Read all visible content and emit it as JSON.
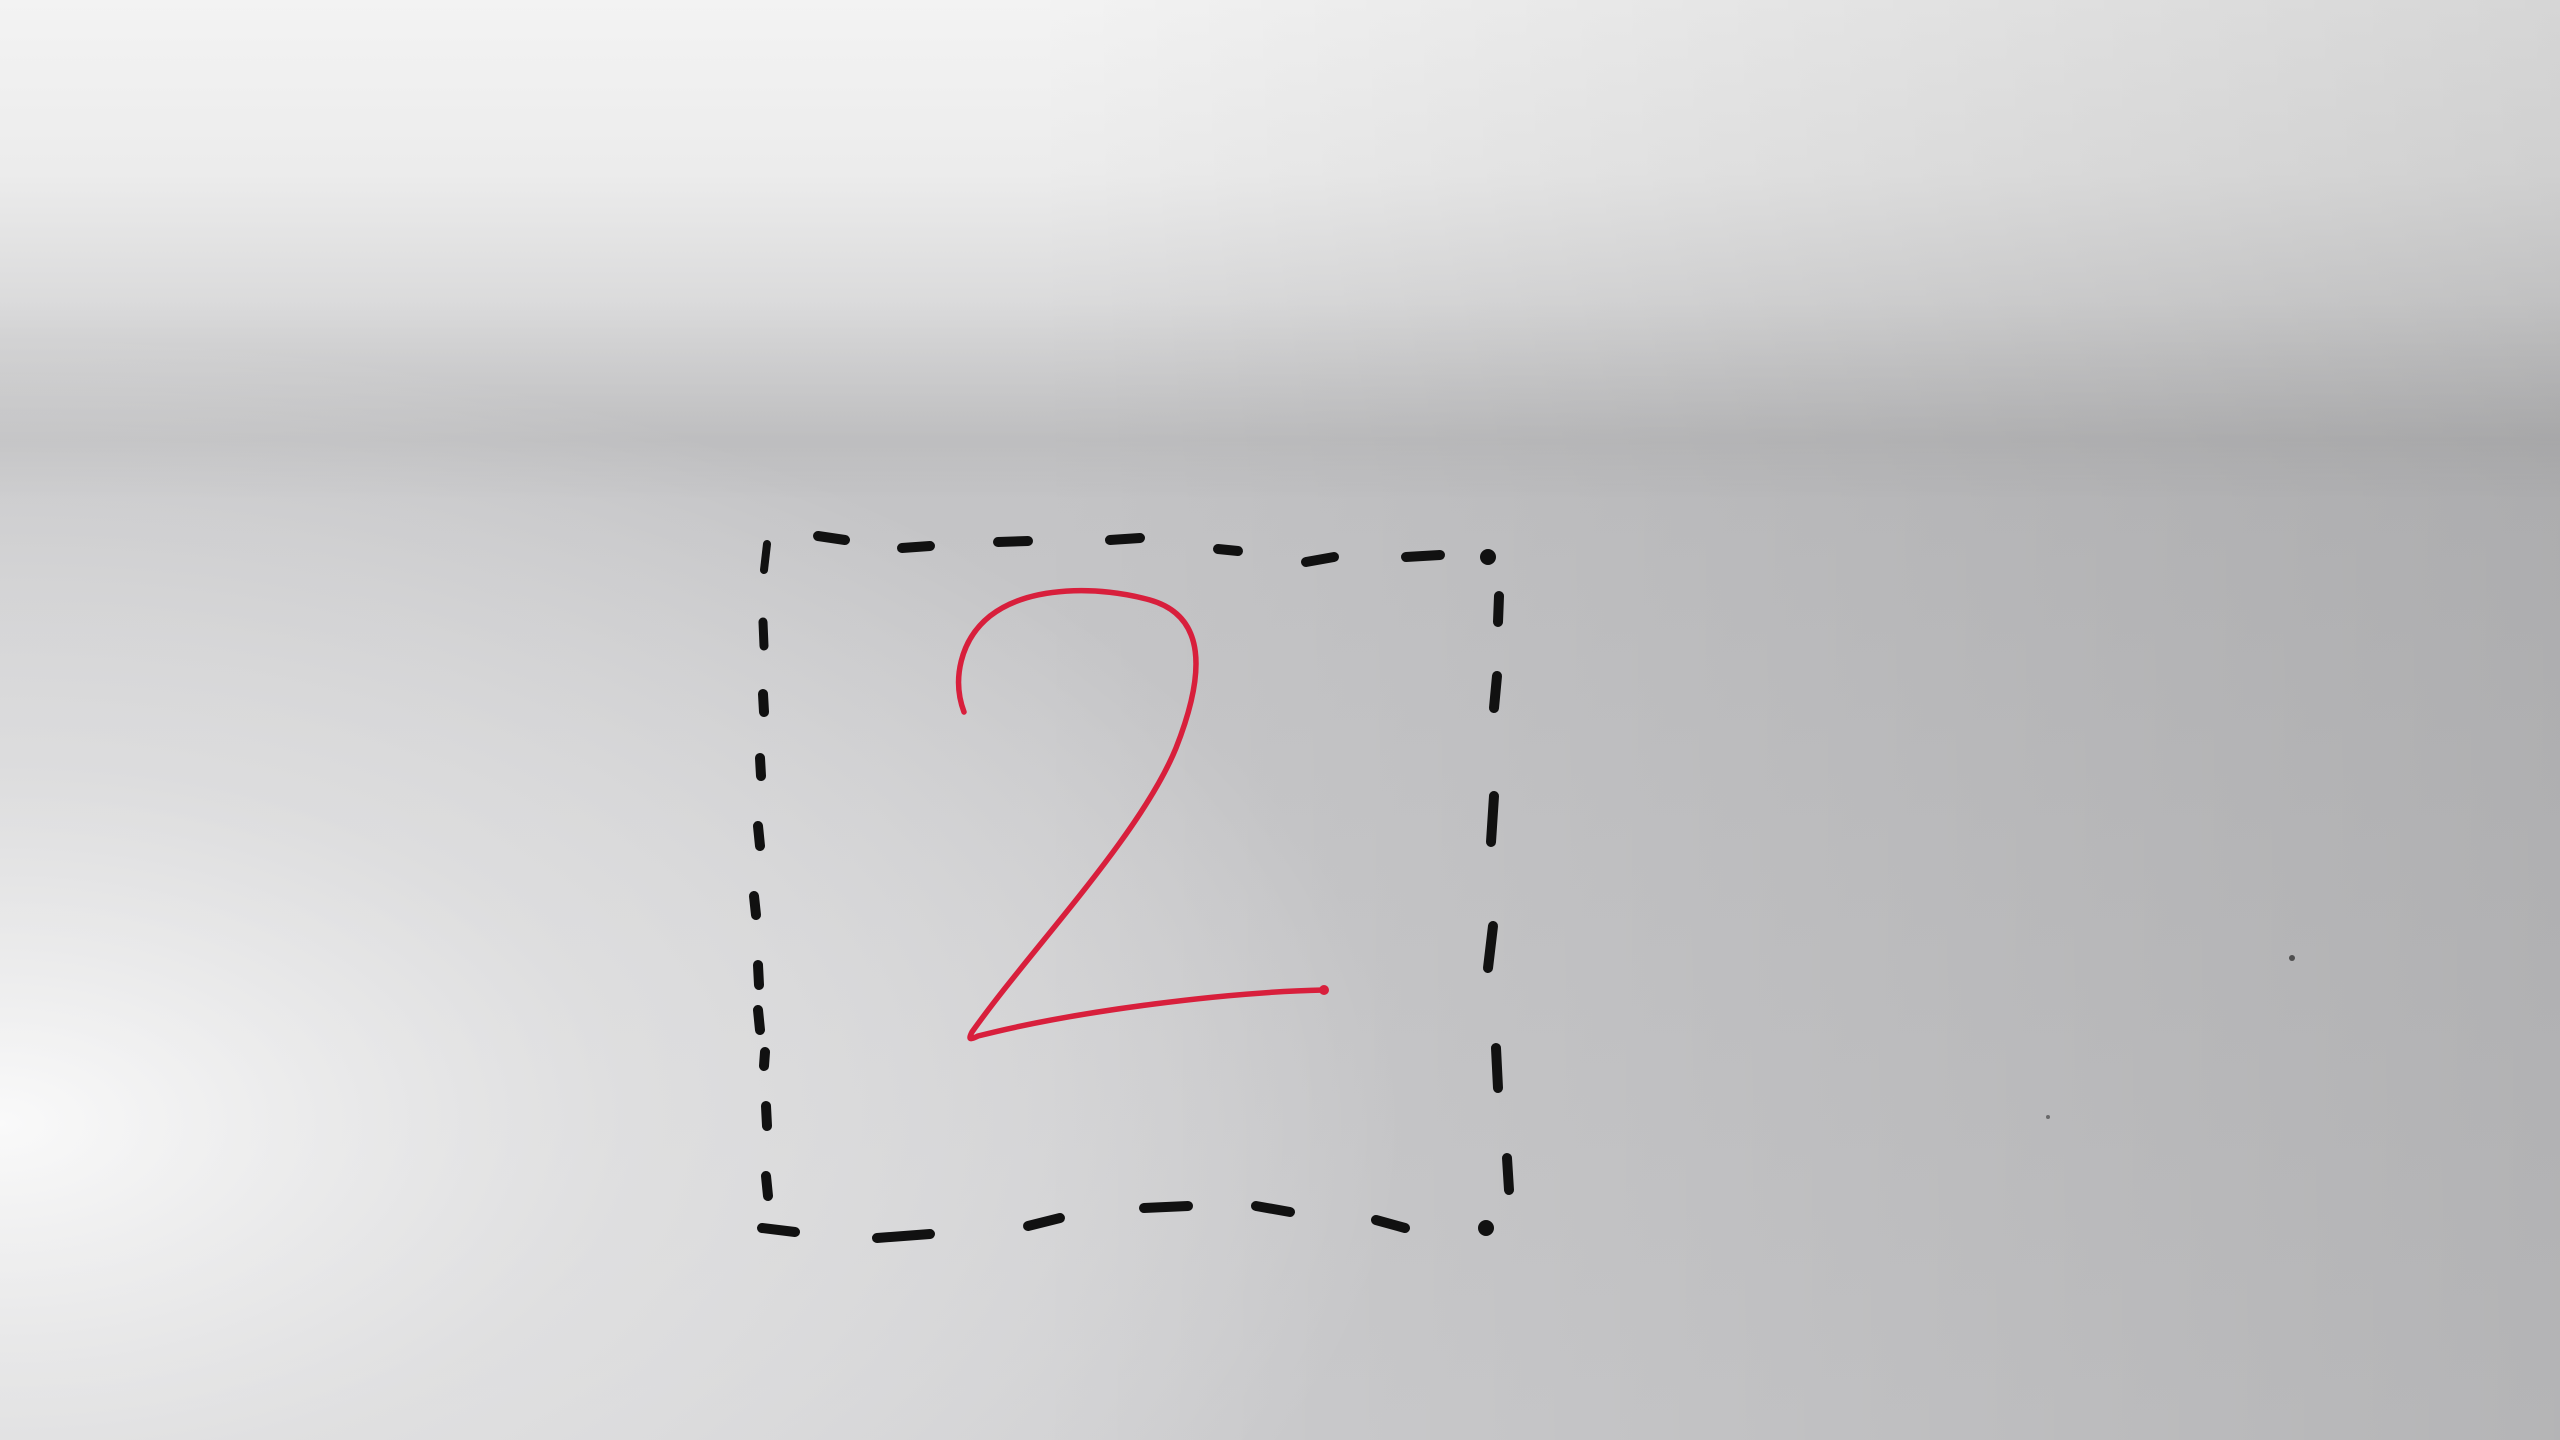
{
  "scene": {
    "description_kind": "photograph",
    "paper_color": "#d8d8da",
    "highlight_color": "#f4f4f4",
    "shadow_color": "#a9aaac"
  },
  "handwriting": {
    "digit": "2",
    "digit_color": "#d81f3c",
    "box_color": "#111111",
    "box_style": "dashed"
  }
}
